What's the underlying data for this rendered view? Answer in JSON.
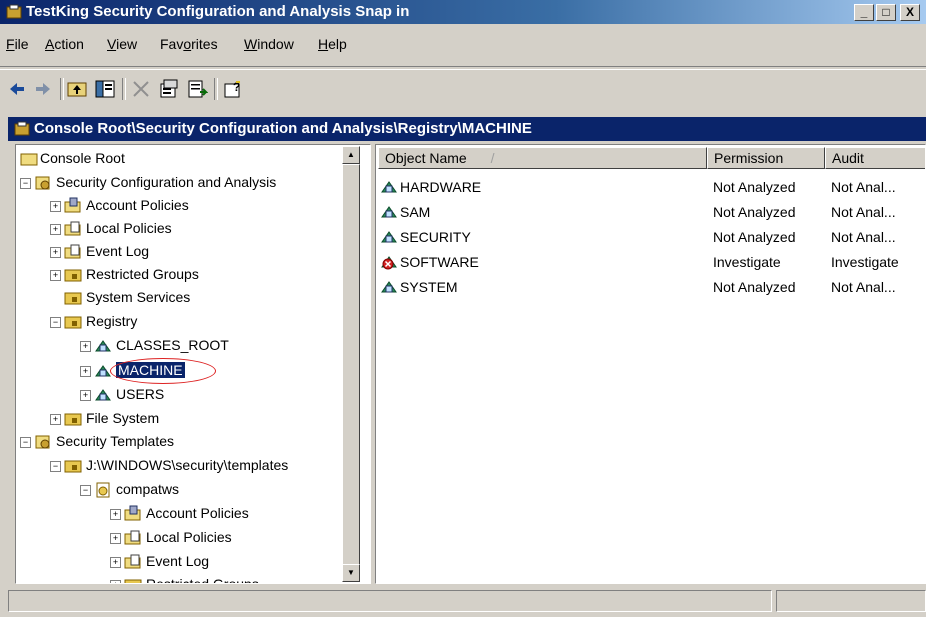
{
  "app": {
    "title": "TestKing Security Configuration and Analysis Snap in"
  },
  "window_controls": {
    "minimize": "_",
    "maximize": "□",
    "close": "X"
  },
  "menu": {
    "file": {
      "prefix": "",
      "accel": "F",
      "suffix": "ile"
    },
    "action": {
      "prefix": "",
      "accel": "A",
      "suffix": "ction"
    },
    "view": {
      "prefix": "",
      "accel": "V",
      "suffix": "iew"
    },
    "favorites": {
      "prefix": "Fav",
      "accel": "o",
      "suffix": "rites"
    },
    "window": {
      "prefix": "",
      "accel": "W",
      "suffix": "indow"
    },
    "help": {
      "prefix": "",
      "accel": "H",
      "suffix": "elp"
    }
  },
  "toolbar": {
    "buttons": [
      "back-icon",
      "forward-icon",
      "up-folder-icon",
      "show-hide-tree-icon",
      "delete-icon",
      "properties-icon",
      "export-list-icon",
      "help-icon"
    ]
  },
  "inner_window": {
    "title": "Console Root\\Security Configuration and Analysis\\Registry\\MACHINE"
  },
  "tree": {
    "console_root": "Console Root",
    "sca": "Security Configuration and Analysis",
    "account_policies": "Account Policies",
    "local_policies": "Local Policies",
    "event_log": "Event Log",
    "restricted_groups": "Restricted Groups",
    "system_services": "System Services",
    "registry": "Registry",
    "classes_root": "CLASSES_ROOT",
    "machine": "MACHINE",
    "users": "USERS",
    "file_system": "File System",
    "security_templates": "Security Templates",
    "templates_path": "J:\\WINDOWS\\security\\templates",
    "compatws": "compatws",
    "t_account_policies": "Account Policies",
    "t_local_policies": "Local Policies",
    "t_event_log": "Event Log",
    "t_restricted_groups": "Restricted Groups"
  },
  "list": {
    "columns": {
      "object_name": "Object Name",
      "permission": "Permission",
      "audit": "Audit"
    },
    "sort_indicator": "/",
    "rows": [
      {
        "name": "HARDWARE",
        "permission": "Not Analyzed",
        "audit": "Not Anal...",
        "status": "ok"
      },
      {
        "name": "SAM",
        "permission": "Not Analyzed",
        "audit": "Not Anal...",
        "status": "ok"
      },
      {
        "name": "SECURITY",
        "permission": "Not Analyzed",
        "audit": "Not Anal...",
        "status": "ok"
      },
      {
        "name": "SOFTWARE",
        "permission": "Investigate",
        "audit": "Investigate",
        "status": "investigate"
      },
      {
        "name": "SYSTEM",
        "permission": "Not Analyzed",
        "audit": "Not Anal...",
        "status": "ok"
      }
    ]
  },
  "colors": {
    "title_bar": "#0a246a",
    "selection": "#0a246a",
    "investigate_marker": "#d22222"
  }
}
